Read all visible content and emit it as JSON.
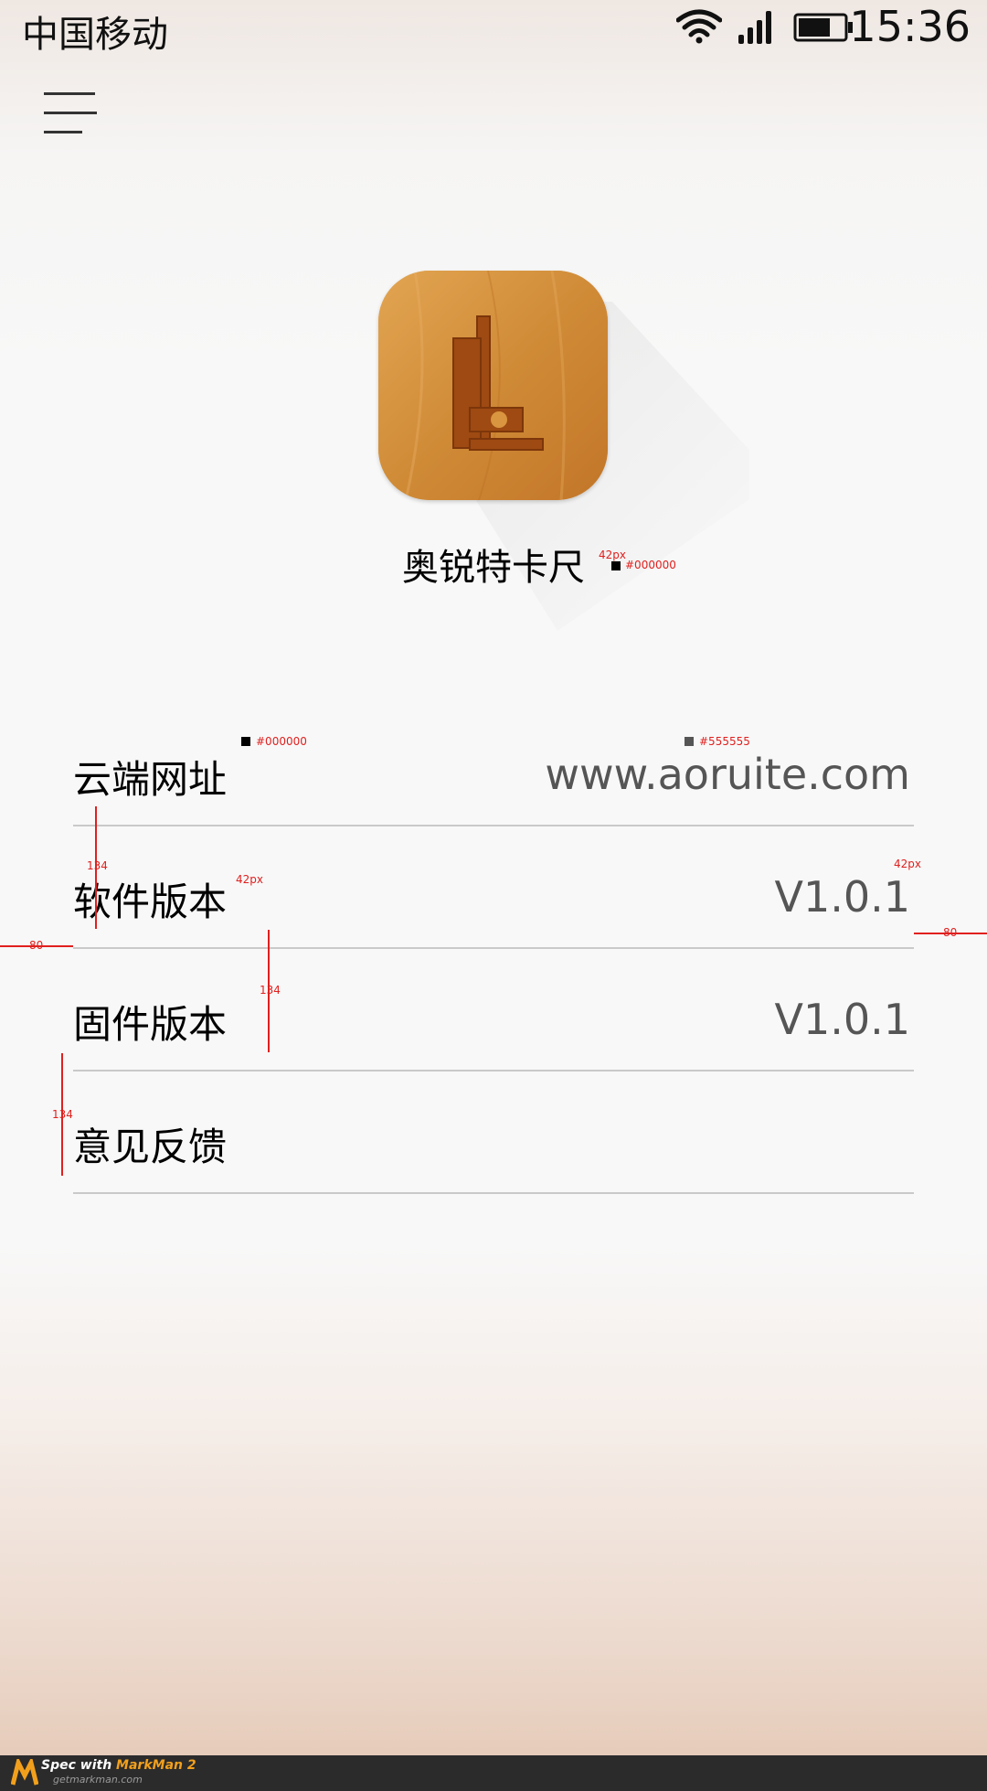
{
  "status_bar": {
    "carrier": "中国移动",
    "time": "15:36",
    "wifi_icon": "wifi-icon",
    "signal_icon": "signal-icon",
    "battery_icon": "battery-icon"
  },
  "header": {
    "menu_icon": "menu-icon"
  },
  "app": {
    "name": "奥锐特卡尺",
    "logo_icon": "caliper-icon",
    "logo_color": "#d4923d"
  },
  "list": [
    {
      "label": "云端网址",
      "value": "www.aoruite.com"
    },
    {
      "label": "软件版本",
      "value": "V1.0.1"
    },
    {
      "label": "固件版本",
      "value": "V1.0.1"
    },
    {
      "label": "意见反馈",
      "value": ""
    }
  ],
  "annotations": {
    "font_size_42": "42px",
    "color_black": "#000000",
    "color_gray": "#555555",
    "row_height": "134",
    "margin": "80"
  },
  "colors": {
    "annotation_red": "#e0201e",
    "value_gray": "#555555",
    "divider": "#c9c9c9"
  },
  "footer": {
    "brand_prefix": "Spec with ",
    "brand_name": "MarkMan 2",
    "url": "getmarkman.com"
  }
}
